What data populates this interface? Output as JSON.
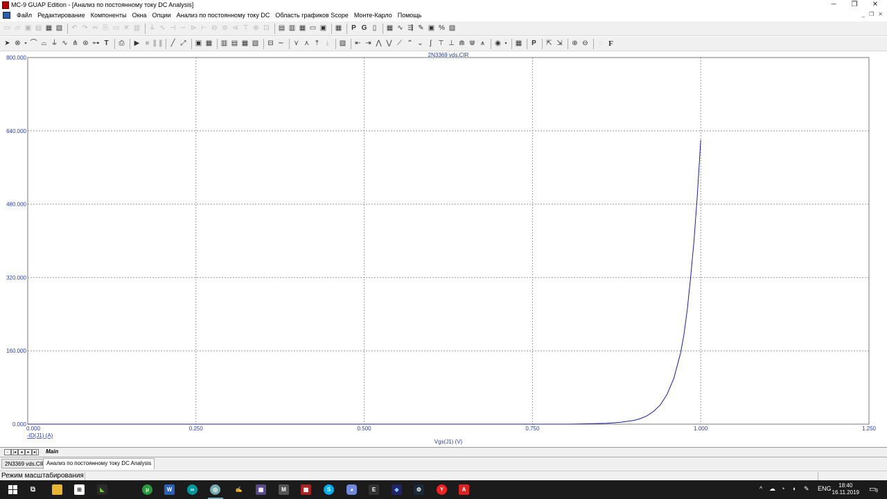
{
  "window": {
    "title": "MC-9 GUAP Edition - [Анализ по постоянному току DC Analysis]",
    "minimize": "─",
    "maximize": "❐",
    "close": "✕"
  },
  "menu": {
    "items": [
      {
        "label": "Файл"
      },
      {
        "label": "Редактирование"
      },
      {
        "label": "Компоненты"
      },
      {
        "label": "Окна"
      },
      {
        "label": "Опции"
      },
      {
        "label": "Анализ по постоянному току DC"
      },
      {
        "label": "Область графиков Scope"
      },
      {
        "label": "Монте-Карло"
      },
      {
        "label": "Помощь"
      }
    ],
    "mdi_controls": [
      "_",
      "❐",
      "✕"
    ]
  },
  "toolbar2_text": {
    "p": "P",
    "g": "G",
    "t": "T",
    "p2": "P",
    "f": "F"
  },
  "chart_data": {
    "type": "line",
    "title": "2N3369 vds.CIR",
    "xlabel": "Vgs(J1) (V)",
    "ylabel": "-ID(J1) (A)",
    "xlim": [
      0,
      1.25
    ],
    "ylim": [
      0,
      800
    ],
    "x_ticks": [
      "0.000",
      "0.250",
      "0.500",
      "0.750",
      "1.000",
      "1.250"
    ],
    "y_ticks": [
      "0.000",
      "160.000",
      "320.000",
      "480.000",
      "640.000",
      "800.000"
    ],
    "grid": true,
    "series": [
      {
        "color": "#1c1c9a",
        "x": [
          0.8,
          0.82,
          0.84,
          0.86,
          0.88,
          0.9,
          0.91,
          0.92,
          0.93,
          0.94,
          0.95,
          0.96,
          0.97,
          0.975,
          0.98,
          0.985,
          0.99,
          0.995,
          1.0
        ],
        "y": [
          0,
          0.5,
          1,
          2,
          4,
          8,
          12,
          18,
          28,
          42,
          65,
          100,
          155,
          195,
          250,
          320,
          400,
          500,
          620
        ]
      }
    ]
  },
  "tabs": {
    "nav": [
      "-",
      "|◂",
      "◂",
      "▸",
      "▸|"
    ],
    "main": "Main"
  },
  "window_tabs": [
    {
      "label": "2N3369 vds.CIR"
    },
    {
      "label": "Анализ по постоянному току DC Analysis"
    }
  ],
  "status": {
    "text": "Режим масштабирования"
  },
  "taskbar": {
    "lang": "ENG",
    "time": "18:40",
    "date": "16.11.2019",
    "notif_count": "3",
    "caret": "^"
  }
}
